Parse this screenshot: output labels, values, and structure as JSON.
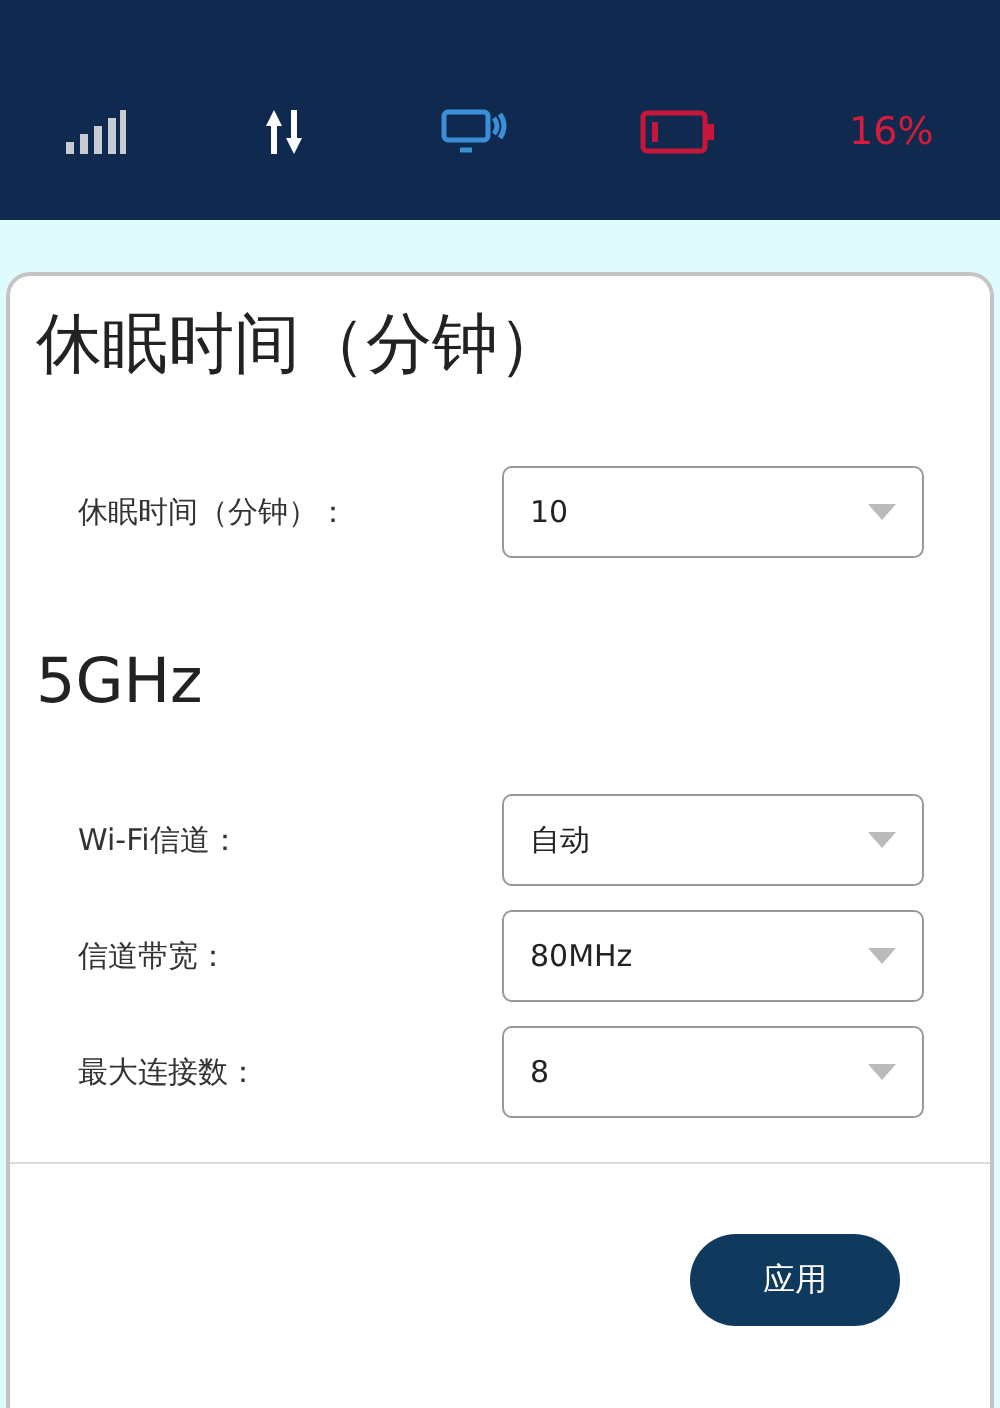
{
  "status_bar": {
    "battery_text": "16%"
  },
  "sections": [
    {
      "title": "休眠时间（分钟）",
      "fields": [
        {
          "label": "休眠时间（分钟）：",
          "value": "10"
        }
      ]
    },
    {
      "title": "5GHz",
      "fields": [
        {
          "label": "Wi-Fi信道：",
          "value": "自动"
        },
        {
          "label": "信道带宽：",
          "value": "80MHz"
        },
        {
          "label": "最大连接数：",
          "value": "8"
        }
      ]
    }
  ],
  "apply_button": "应用"
}
